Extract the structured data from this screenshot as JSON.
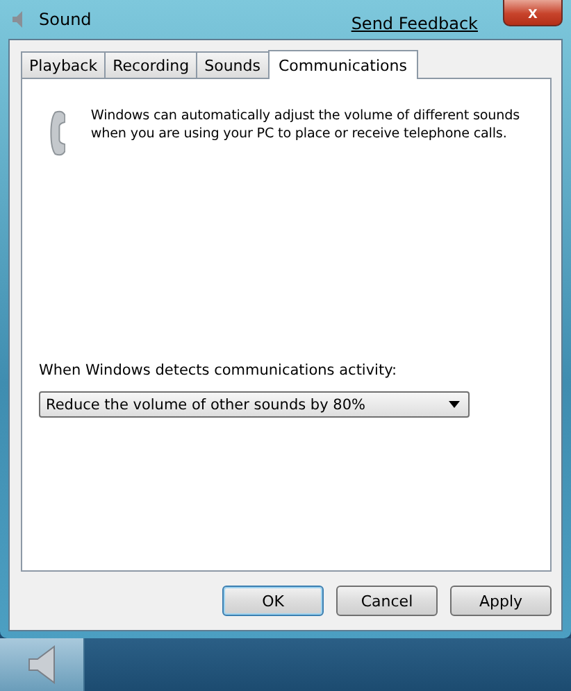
{
  "window": {
    "title": "Sound",
    "feedback_link": "Send Feedback",
    "close_glyph": "x"
  },
  "tabs": [
    {
      "label": "Playback",
      "selected": false
    },
    {
      "label": "Recording",
      "selected": false
    },
    {
      "label": "Sounds",
      "selected": false
    },
    {
      "label": "Communications",
      "selected": true
    }
  ],
  "description": "Windows can automatically adjust the volume of different sounds when you are using your PC to place or receive telephone calls.",
  "activity_label": "When Windows detects communications activity:",
  "activity_dropdown": {
    "value": "Reduce the volume of other sounds by 80%"
  },
  "buttons": [
    {
      "label": "OK",
      "default": true
    },
    {
      "label": "Cancel",
      "default": false
    },
    {
      "label": "Apply",
      "default": false
    }
  ]
}
